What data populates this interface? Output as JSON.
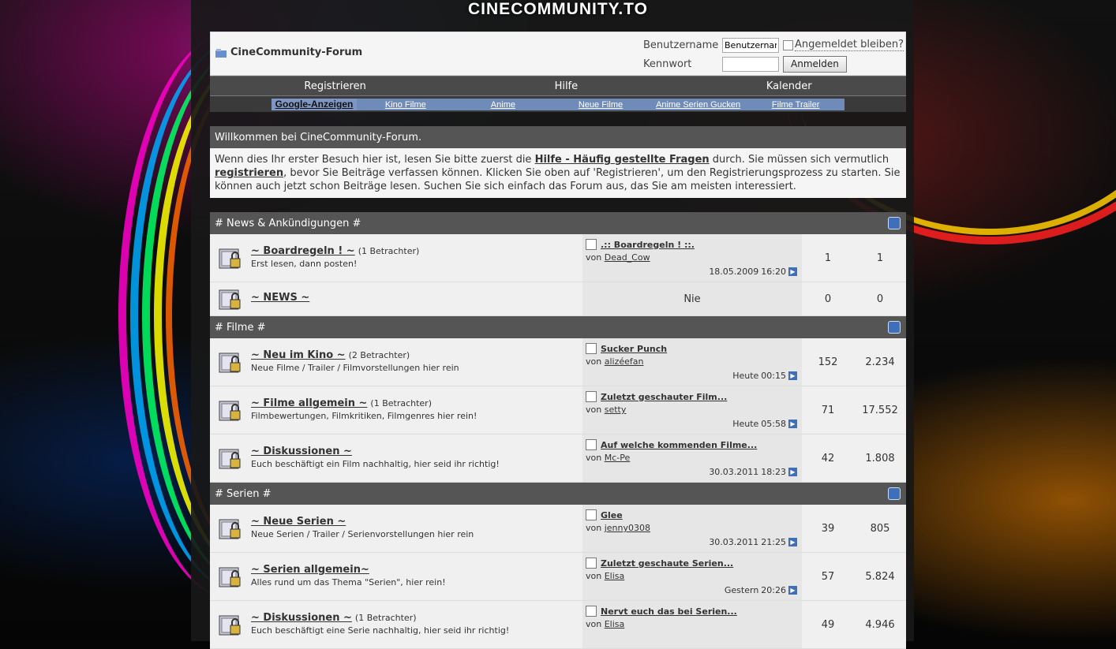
{
  "site": {
    "logo": "CINECOMMUNITY.TO"
  },
  "header": {
    "forum_title": "CineCommunity-Forum",
    "username_label": "Benutzername",
    "username_value": "Benutzername",
    "remember_label": "Angemeldet bleiben?",
    "password_label": "Kennwort",
    "login_button": "Anmelden"
  },
  "nav": {
    "items": [
      "Registrieren",
      "Hilfe",
      "Kalender"
    ]
  },
  "ads": {
    "items": [
      "Google-Anzeigen",
      "Kino Filme",
      "Anime",
      "Neue Filme",
      "Anime Serien Gucken",
      "Filme Trailer"
    ]
  },
  "welcome": {
    "title": "Willkommen bei CineCommunity-Forum.",
    "text1": "Wenn dies Ihr erster Besuch hier ist, lesen Sie bitte zuerst die ",
    "link1": "Hilfe - Häufig gestellte Fragen",
    "text2": " durch. Sie müssen sich vermutlich ",
    "link2": "registrieren",
    "text3": ", bevor Sie Beiträge verfassen können. Klicken Sie oben auf 'Registrieren', um den Registrierungsprozess zu starten. Sie können auch jetzt schon Beiträge lesen. Suchen Sie sich einfach das Forum aus, das Sie am meisten interessiert."
  },
  "categories": [
    {
      "title": "# News & Ankündigungen #",
      "forums": [
        {
          "name": "~ Boardregeln ! ~",
          "viewers": "(1 Betrachter)",
          "desc": "Erst lesen, dann posten!",
          "last_title": ".:: Boardregeln ! ::.",
          "by": "von",
          "user": "Dead_Cow",
          "date": "18.05.2009",
          "time": "16:20",
          "threads": "1",
          "posts": "1"
        },
        {
          "name": "~ NEWS ~",
          "never": "Nie",
          "threads": "0",
          "posts": "0"
        }
      ]
    },
    {
      "title": "# Filme #",
      "forums": [
        {
          "name": "~ Neu im Kino ~",
          "viewers": "(2 Betrachter)",
          "desc": "Neue Filme / Trailer / Filmvorstellungen hier rein",
          "last_title": "Sucker Punch",
          "by": "von",
          "user": "alizéefan",
          "date": "Heute",
          "time": "00:15",
          "threads": "152",
          "posts": "2.234"
        },
        {
          "name": "~ Filme allgemein ~",
          "viewers": "(1 Betrachter)",
          "desc": "Filmbewertungen, Filmkritiken, Filmgenres hier rein!",
          "last_title": "Zuletzt geschauter Film...",
          "by": "von",
          "user": "setty",
          "date": "Heute",
          "time": "05:58",
          "threads": "71",
          "posts": "17.552"
        },
        {
          "name": "~ Diskussionen ~",
          "desc": "Euch beschäftigt ein Film nachhaltig, hier seid ihr richtig!",
          "last_title": "Auf welche kommenden Filme...",
          "by": "von",
          "user": "Mc-Pe",
          "date": "30.03.2011",
          "time": "18:23",
          "threads": "42",
          "posts": "1.808"
        }
      ]
    },
    {
      "title": "# Serien #",
      "forums": [
        {
          "name": "~ Neue Serien ~",
          "desc": "Neue Serien / Trailer / Serienvorstellungen hier rein",
          "last_title": "Glee",
          "by": "von",
          "user": "jenny0308",
          "date": "30.03.2011",
          "time": "21:25",
          "threads": "39",
          "posts": "805"
        },
        {
          "name": "~ Serien allgemein~",
          "desc": "Alles rund um das Thema \"Serien\", hier rein!",
          "last_title": "Zuletzt geschaute Serien...",
          "by": "von",
          "user": "Elisa",
          "date": "Gestern",
          "time": "20:26",
          "threads": "57",
          "posts": "5.824"
        },
        {
          "name": "~ Diskussionen ~",
          "viewers": "(1 Betrachter)",
          "desc": "Euch beschäftigt eine Serie nachhaltig, hier seid ihr richtig!",
          "last_title": "Nervt euch das bei Serien...",
          "by": "von",
          "user": "Elisa",
          "date": "",
          "time": "",
          "threads": "49",
          "posts": "4.946"
        }
      ]
    }
  ]
}
